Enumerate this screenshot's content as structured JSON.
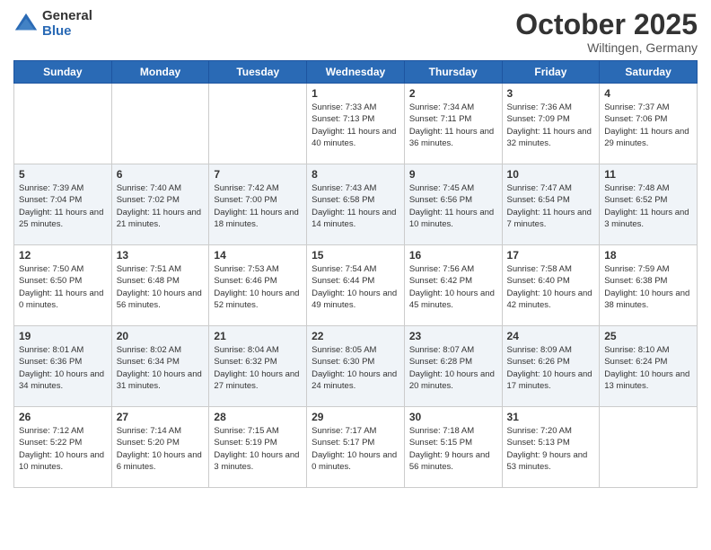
{
  "header": {
    "logo_general": "General",
    "logo_blue": "Blue",
    "month": "October 2025",
    "location": "Wiltingen, Germany"
  },
  "days_of_week": [
    "Sunday",
    "Monday",
    "Tuesday",
    "Wednesday",
    "Thursday",
    "Friday",
    "Saturday"
  ],
  "weeks": [
    [
      {
        "day": "",
        "info": ""
      },
      {
        "day": "",
        "info": ""
      },
      {
        "day": "",
        "info": ""
      },
      {
        "day": "1",
        "info": "Sunrise: 7:33 AM\nSunset: 7:13 PM\nDaylight: 11 hours\nand 40 minutes."
      },
      {
        "day": "2",
        "info": "Sunrise: 7:34 AM\nSunset: 7:11 PM\nDaylight: 11 hours\nand 36 minutes."
      },
      {
        "day": "3",
        "info": "Sunrise: 7:36 AM\nSunset: 7:09 PM\nDaylight: 11 hours\nand 32 minutes."
      },
      {
        "day": "4",
        "info": "Sunrise: 7:37 AM\nSunset: 7:06 PM\nDaylight: 11 hours\nand 29 minutes."
      }
    ],
    [
      {
        "day": "5",
        "info": "Sunrise: 7:39 AM\nSunset: 7:04 PM\nDaylight: 11 hours\nand 25 minutes."
      },
      {
        "day": "6",
        "info": "Sunrise: 7:40 AM\nSunset: 7:02 PM\nDaylight: 11 hours\nand 21 minutes."
      },
      {
        "day": "7",
        "info": "Sunrise: 7:42 AM\nSunset: 7:00 PM\nDaylight: 11 hours\nand 18 minutes."
      },
      {
        "day": "8",
        "info": "Sunrise: 7:43 AM\nSunset: 6:58 PM\nDaylight: 11 hours\nand 14 minutes."
      },
      {
        "day": "9",
        "info": "Sunrise: 7:45 AM\nSunset: 6:56 PM\nDaylight: 11 hours\nand 10 minutes."
      },
      {
        "day": "10",
        "info": "Sunrise: 7:47 AM\nSunset: 6:54 PM\nDaylight: 11 hours\nand 7 minutes."
      },
      {
        "day": "11",
        "info": "Sunrise: 7:48 AM\nSunset: 6:52 PM\nDaylight: 11 hours\nand 3 minutes."
      }
    ],
    [
      {
        "day": "12",
        "info": "Sunrise: 7:50 AM\nSunset: 6:50 PM\nDaylight: 11 hours\nand 0 minutes."
      },
      {
        "day": "13",
        "info": "Sunrise: 7:51 AM\nSunset: 6:48 PM\nDaylight: 10 hours\nand 56 minutes."
      },
      {
        "day": "14",
        "info": "Sunrise: 7:53 AM\nSunset: 6:46 PM\nDaylight: 10 hours\nand 52 minutes."
      },
      {
        "day": "15",
        "info": "Sunrise: 7:54 AM\nSunset: 6:44 PM\nDaylight: 10 hours\nand 49 minutes."
      },
      {
        "day": "16",
        "info": "Sunrise: 7:56 AM\nSunset: 6:42 PM\nDaylight: 10 hours\nand 45 minutes."
      },
      {
        "day": "17",
        "info": "Sunrise: 7:58 AM\nSunset: 6:40 PM\nDaylight: 10 hours\nand 42 minutes."
      },
      {
        "day": "18",
        "info": "Sunrise: 7:59 AM\nSunset: 6:38 PM\nDaylight: 10 hours\nand 38 minutes."
      }
    ],
    [
      {
        "day": "19",
        "info": "Sunrise: 8:01 AM\nSunset: 6:36 PM\nDaylight: 10 hours\nand 34 minutes."
      },
      {
        "day": "20",
        "info": "Sunrise: 8:02 AM\nSunset: 6:34 PM\nDaylight: 10 hours\nand 31 minutes."
      },
      {
        "day": "21",
        "info": "Sunrise: 8:04 AM\nSunset: 6:32 PM\nDaylight: 10 hours\nand 27 minutes."
      },
      {
        "day": "22",
        "info": "Sunrise: 8:05 AM\nSunset: 6:30 PM\nDaylight: 10 hours\nand 24 minutes."
      },
      {
        "day": "23",
        "info": "Sunrise: 8:07 AM\nSunset: 6:28 PM\nDaylight: 10 hours\nand 20 minutes."
      },
      {
        "day": "24",
        "info": "Sunrise: 8:09 AM\nSunset: 6:26 PM\nDaylight: 10 hours\nand 17 minutes."
      },
      {
        "day": "25",
        "info": "Sunrise: 8:10 AM\nSunset: 6:24 PM\nDaylight: 10 hours\nand 13 minutes."
      }
    ],
    [
      {
        "day": "26",
        "info": "Sunrise: 7:12 AM\nSunset: 5:22 PM\nDaylight: 10 hours\nand 10 minutes."
      },
      {
        "day": "27",
        "info": "Sunrise: 7:14 AM\nSunset: 5:20 PM\nDaylight: 10 hours\nand 6 minutes."
      },
      {
        "day": "28",
        "info": "Sunrise: 7:15 AM\nSunset: 5:19 PM\nDaylight: 10 hours\nand 3 minutes."
      },
      {
        "day": "29",
        "info": "Sunrise: 7:17 AM\nSunset: 5:17 PM\nDaylight: 10 hours\nand 0 minutes."
      },
      {
        "day": "30",
        "info": "Sunrise: 7:18 AM\nSunset: 5:15 PM\nDaylight: 9 hours\nand 56 minutes."
      },
      {
        "day": "31",
        "info": "Sunrise: 7:20 AM\nSunset: 5:13 PM\nDaylight: 9 hours\nand 53 minutes."
      },
      {
        "day": "",
        "info": ""
      }
    ]
  ]
}
